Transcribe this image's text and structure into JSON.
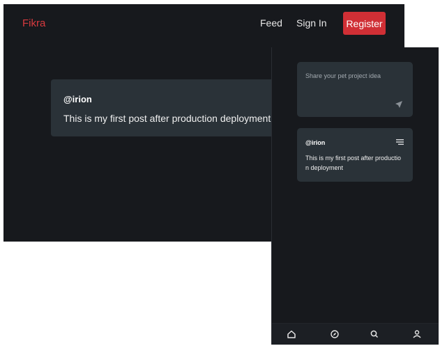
{
  "desktop": {
    "brand": "Fikra",
    "nav": {
      "feed": "Feed",
      "sign_in": "Sign In",
      "register": "Register"
    },
    "post": {
      "author": "@irion",
      "text": "This is my first post after production deployment"
    }
  },
  "mobile": {
    "composer": {
      "placeholder": "Share your pet project idea"
    },
    "post": {
      "author": "@irion",
      "text": "This is my first post after production deployment"
    },
    "tabs": [
      "home-icon",
      "compass-icon",
      "search-icon",
      "user-icon"
    ]
  },
  "colors": {
    "background": "#17191d",
    "card": "#2a3238",
    "accent": "#d02f35",
    "brand": "#d83a3f"
  }
}
